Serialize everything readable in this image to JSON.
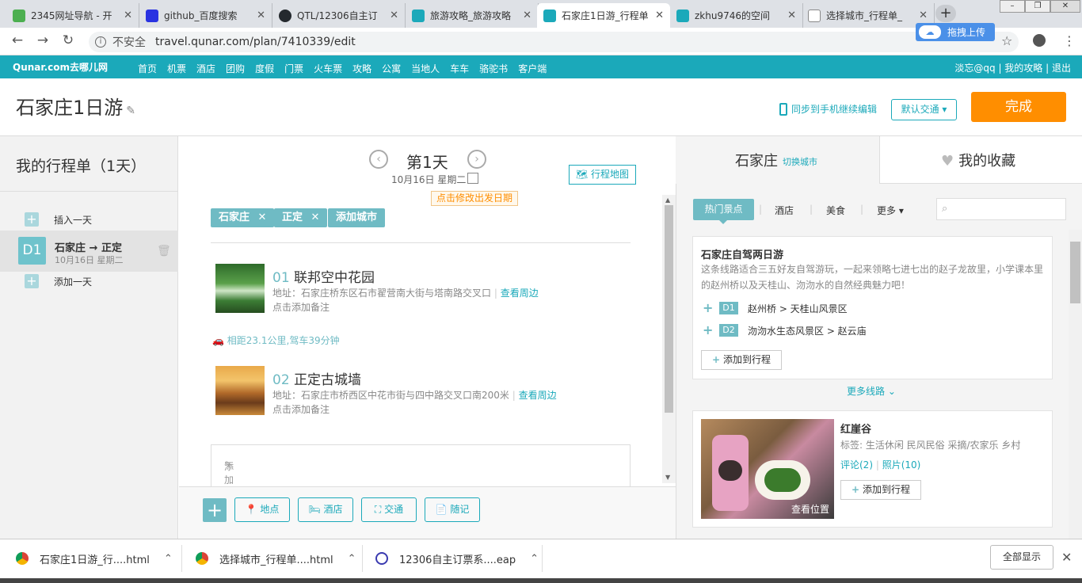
{
  "browser": {
    "tabs": [
      {
        "title": "2345网址导航 - 开",
        "favicon_color": "#4caf50"
      },
      {
        "title": "github_百度搜索",
        "favicon_color": "#2932e1"
      },
      {
        "title": "QTL/12306自主订",
        "favicon_color": "#24292e"
      },
      {
        "title": "旅游攻略_旅游攻略",
        "favicon_color": "#1ba9ba"
      },
      {
        "title": "石家庄1日游_行程单",
        "favicon_color": "#1ba9ba",
        "active": true
      },
      {
        "title": "zkhu9746的空间",
        "favicon_color": "#1ba9ba"
      },
      {
        "title": "选择城市_行程单_",
        "favicon_color": "#888888"
      }
    ],
    "not_secure": "不安全",
    "url": "travel.qunar.com/plan/7410339/edit",
    "upload_label": "拖拽上传"
  },
  "qunar_nav": {
    "logo": "Qunar.com去哪儿网",
    "links": [
      "首页",
      "机票",
      "酒店",
      "团购",
      "度假",
      "门票",
      "火车票",
      "攻略",
      "公寓",
      "当地人",
      "车车",
      "骆驼书",
      "客户端"
    ],
    "user": "淡忘@qq",
    "my_guides": "我的攻略",
    "logout": "退出"
  },
  "header": {
    "title": "石家庄1日游",
    "sync": "同步到手机继续编辑",
    "transport": "默认交通",
    "done": "完成"
  },
  "left": {
    "title": "我的行程单（1天）",
    "insert_day": "插入一天",
    "day_badge": "D1",
    "day_route": "石家庄 → 正定",
    "day_date": "10月16日  星期二",
    "add_day": "添加一天"
  },
  "middle": {
    "day_title": "第1天",
    "date": "10月16日  星期二",
    "change_date": "点击修改出发日期",
    "map_button": "行程地图",
    "cities": [
      "石家庄",
      "正定"
    ],
    "add_city": "添加城市",
    "pois": [
      {
        "num": "01",
        "name": "联邦空中花园",
        "addr": "地址：石家庄桥东区石市翟营南大街与塔南路交叉口",
        "nearby": "查看周边",
        "note": "点击添加备注"
      },
      {
        "num": "02",
        "name": "正定古城墙",
        "addr": "地址：石家庄市桥西区中花市街与四中路交叉口南200米",
        "nearby": "查看周边",
        "note": "点击添加备注"
      }
    ],
    "distance": "相距23.1公里,驾车39分钟",
    "day_note": "添加当日备注",
    "bottom": {
      "place": "地点",
      "hotel": "酒店",
      "traffic": "交通",
      "notes": "随记"
    }
  },
  "right": {
    "city": "石家庄",
    "switch_city": "切换城市",
    "favorites": "我的收藏",
    "filters": {
      "hot": "热门景点",
      "hotel": "酒店",
      "food": "美食",
      "more": "更多"
    },
    "route": {
      "title": "石家庄自驾两日游",
      "desc": "这条线路适合三五好友自驾游玩，一起来领略七进七出的赵子龙故里，小学课本里的赵州桥以及天桂山、沕沕水的自然经典魅力吧！",
      "d1_badge": "D1",
      "d1": "赵州桥  >  天桂山风景区",
      "d2_badge": "D2",
      "d2": "沕沕水生态风景区  >  赵云庙",
      "add": "添加到行程"
    },
    "more_routes": "更多线路",
    "spot": {
      "name": "红崖谷",
      "tags": "标签: 生活休闲 民风民俗 采摘/农家乐 乡村",
      "reviews": "评论(2)",
      "photos": "照片(10)",
      "view_location": "查看位置",
      "add": "添加到行程"
    }
  },
  "downloads": {
    "items": [
      "石家庄1日游_行....html",
      "选择城市_行程单....html",
      "12306自主订票系....eap"
    ],
    "show_all": "全部显示"
  }
}
